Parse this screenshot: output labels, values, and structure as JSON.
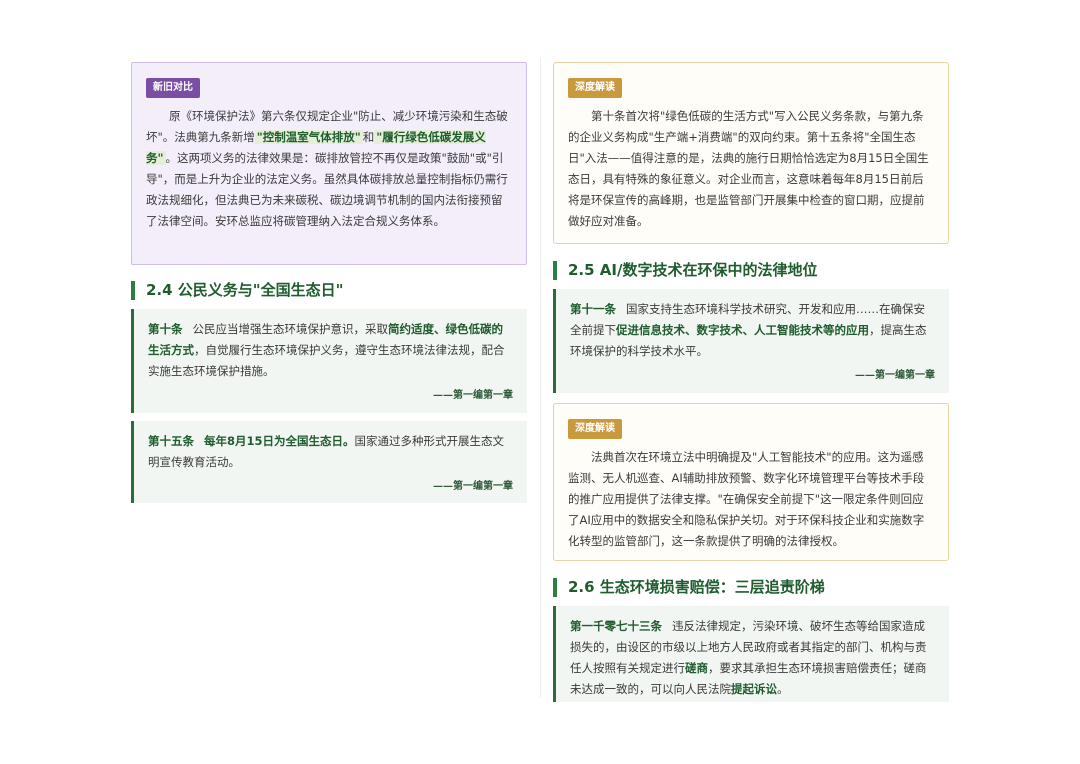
{
  "left": {
    "compare": {
      "tag": "新旧对比",
      "text1": "原《环境保护法》第六条仅规定企业\"防止、减少环境污染和生态破坏\"。法典第九条新增",
      "hl1": "\"控制温室气体排放\"",
      "text2": "和",
      "hl2": "\"履行绿色低碳发展义务\"",
      "text3": "。这两项义务的法律效果是：碳排放管控不再仅是政策\"鼓励\"或\"引导\"，而是上升为企业的法定义务。虽然具体碳排放总量控制指标仍需行政法规细化，但法典已为未来碳税、碳边境调节机制的国内法衔接预留了法律空间。安环总监应将碳管理纳入法定合规义务体系。"
    },
    "section_2_4": {
      "title": "2.4 公民义务与\"全国生态日\"",
      "art10": {
        "no": "第十条",
        "t1": "公民应当增强生态环境保护意识，采取",
        "b1": "简约适度、绿色低碳的生活方式",
        "t2": "，自觉履行生态环境保护义务，遵守生态环境法律法规，配合实施生态环境保护措施。",
        "source": "——第一编第一章"
      },
      "art15": {
        "no": "第十五条",
        "b1": "每年8月15日为全国生态日。",
        "t1": "国家通过多种形式开展生态文明宣传教育活动。",
        "source": "——第一编第一章"
      }
    }
  },
  "right": {
    "insight1": {
      "tag": "深度解读",
      "text": "第十条首次将\"绿色低碳的生活方式\"写入公民义务条款，与第九条的企业义务构成\"生产端+消费端\"的双向约束。第十五条将\"全国生态日\"入法——值得注意的是，法典的施行日期恰恰选定为8月15日全国生态日，具有特殊的象征意义。对企业而言，这意味着每年8月15日前后将是环保宣传的高峰期，也是监管部门开展集中检查的窗口期，应提前做好应对准备。"
    },
    "section_2_5": {
      "title": "2.5 AI/数字技术在环保中的法律地位",
      "art11": {
        "no": "第十一条",
        "t1": "国家支持生态环境科学技术研究、开发和应用……在确保安全前提下",
        "b1": "促进信息技术、数字技术、人工智能技术等的应用",
        "t2": "，提高生态环境保护的科学技术水平。",
        "source": "——第一编第一章"
      }
    },
    "insight2": {
      "tag": "深度解读",
      "text": "法典首次在环境立法中明确提及\"人工智能技术\"的应用。这为遥感监测、无人机巡查、AI辅助排放预警、数字化环境管理平台等技术手段的推广应用提供了法律支撑。\"在确保安全前提下\"这一限定条件则回应了AI应用中的数据安全和隐私保护关切。对于环保科技企业和实施数字化转型的监管部门，这一条款提供了明确的法律授权。"
    },
    "section_2_6": {
      "title": "2.6 生态环境损害赔偿：三层追责阶梯",
      "art1073": {
        "no": "第一千零七十三条",
        "t1": "违反法律规定，污染环境、破坏生态等给国家造成损失的，由设区的市级以上地方人民政府或者其指定的部门、机构与责任人按照有关规定进行",
        "b1": "磋商",
        "t2": "，要求其承担生态环境损害赔偿责任；磋商未达成一致的，可以向人民法院",
        "b2": "提起诉讼",
        "t3": "。"
      }
    }
  }
}
